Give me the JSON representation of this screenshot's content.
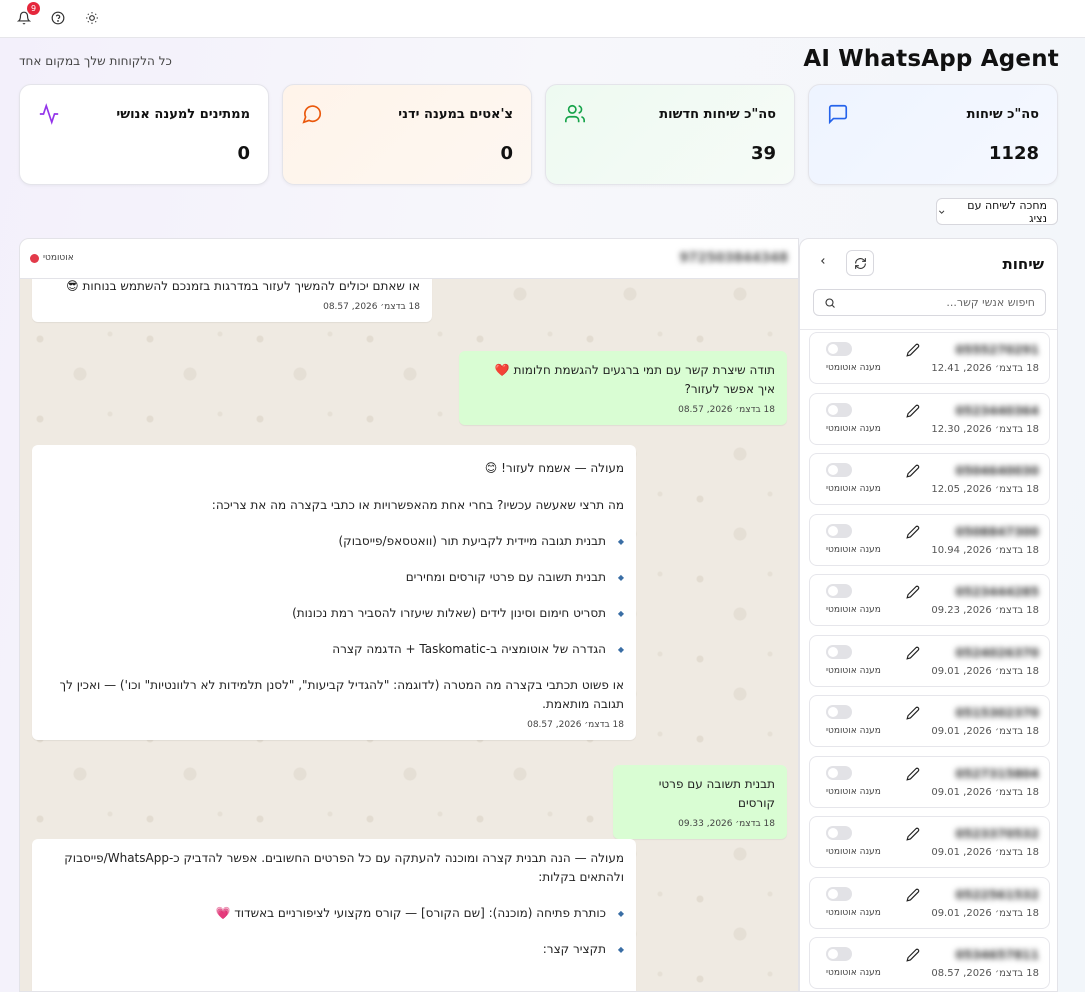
{
  "topbar": {
    "notifications_count": "9",
    "icons": [
      "bell-icon",
      "help-icon",
      "theme-toggle-icon"
    ]
  },
  "header": {
    "title": "AI WhatsApp Agent",
    "subtitle": "כל הלקוחות שלך במקום אחד"
  },
  "stats": [
    {
      "label": "סה\"כ שיחות",
      "value": "1128",
      "icon": "message-square-icon",
      "color": "#2563eb"
    },
    {
      "label": "סה\"כ שיחות חדשות",
      "value": "39",
      "icon": "users-icon",
      "color": "#16a34a"
    },
    {
      "label": "צ'אטים במענה ידני",
      "value": "0",
      "icon": "message-circle-icon",
      "color": "#ea580c"
    },
    {
      "label": "ממתינים למענה אנושי",
      "value": "0",
      "icon": "activity-icon",
      "color": "#9333ea"
    }
  ],
  "filter": {
    "label": "מחכה לשיחה עם נציג"
  },
  "chat_list": {
    "title": "שיחות",
    "search_placeholder": "חיפוש אנשי קשר...",
    "items": [
      {
        "phone": "0555270291",
        "time": "18 בדצמ׳ 2026, 12.41",
        "toggle_label": "מענה אוטומטי"
      },
      {
        "phone": "0523440364",
        "time": "18 בדצמ׳ 2026, 12.30",
        "toggle_label": "מענה אוטומטי"
      },
      {
        "phone": "0504640030",
        "time": "18 בדצמ׳ 2026, 12.05",
        "toggle_label": "מענה אוטומטי"
      },
      {
        "phone": "0508847300",
        "time": "18 בדצמ׳ 2026, 10.94",
        "toggle_label": "מענה אוטומטי"
      },
      {
        "phone": "0523444285",
        "time": "18 בדצמ׳ 2026, 09.23",
        "toggle_label": "מענה אוטומטי"
      },
      {
        "phone": "0524026370",
        "time": "18 בדצמ׳ 2026, 09.01",
        "toggle_label": "מענה אוטומטי"
      },
      {
        "phone": "0515302370",
        "time": "18 בדצמ׳ 2026, 09.01",
        "toggle_label": "מענה אוטומטי"
      },
      {
        "phone": "0527315804",
        "time": "18 בדצמ׳ 2026, 09.01",
        "toggle_label": "מענה אוטומטי"
      },
      {
        "phone": "0523370532",
        "time": "18 בדצמ׳ 2026, 09.01",
        "toggle_label": "מענה אוטומטי"
      },
      {
        "phone": "0522561532",
        "time": "18 בדצמ׳ 2026, 09.01",
        "toggle_label": "מענה אוטומטי"
      },
      {
        "phone": "0534657811",
        "time": "18 בדצמ׳ 2026, 08.57",
        "toggle_label": "מענה אוטומטי"
      }
    ]
  },
  "chat": {
    "phone": "972503844348",
    "auto_label": "אוטומטי",
    "messages": [
      {
        "dir": "in",
        "lines": [
          "או שאתם יכולים להמשיך לעזור במדרגות בזמנכם להשתמש בנוחות 😎"
        ],
        "time": "18 בדצמ׳ 2026, 08.57"
      },
      {
        "dir": "out",
        "lines": [
          "תודה שיצרת קשר עם תמי ברגעים להגשמת חלומות ❤️",
          "איך אפשר לעזור?"
        ],
        "time": "18 בדצמ׳ 2026, 08.57"
      },
      {
        "dir": "in",
        "intro": "מעולה — אשמח לעזור! 😊",
        "question": "מה תרצי שאעשה עכשיו? בחרי אחת מהאפשרויות או כתבי בקצרה מה את צריכה:",
        "bullets": [
          "תבנית תגובה מיידית לקביעת תור (וואטסאפ/פייסבוק)",
          "תבנית תשובה עם פרטי קורסים ומחירים",
          "תסריט חימום וסינון לידים (שאלות שיעזרו להסביר רמת נכונות)",
          "הגדרה של אוטומציה ב-Taskomatic + הדגמה קצרה"
        ],
        "outro": "או פשוט תכתבי בקצרה מה המטרה (לדוגמה: \"להגדיל קביעות\", \"לסנן תלמידות לא רלוונטיות\" וכו') — ואכין לך תגובה מותאמת.",
        "time": "18 בדצמ׳ 2026, 08.57"
      },
      {
        "dir": "out",
        "lines": [
          "תבנית תשובה עם פרטי קורסים"
        ],
        "time": "18 בדצמ׳ 2026, 09.33"
      },
      {
        "dir": "in",
        "intro": "מעולה — הנה תבנית קצרה ומוכנה להעתקה עם כל הפרטים החשובים. אפשר להדביק כ-WhatsApp/פייסבוק ולהתאים בקלות:",
        "bullets": [
          "כותרת פתיחה (מוכנה): [שם הקורס] — קורס מקצועי לציפורניים באשדוד 💗",
          "תקציר קצר:"
        ],
        "time": ""
      }
    ]
  }
}
